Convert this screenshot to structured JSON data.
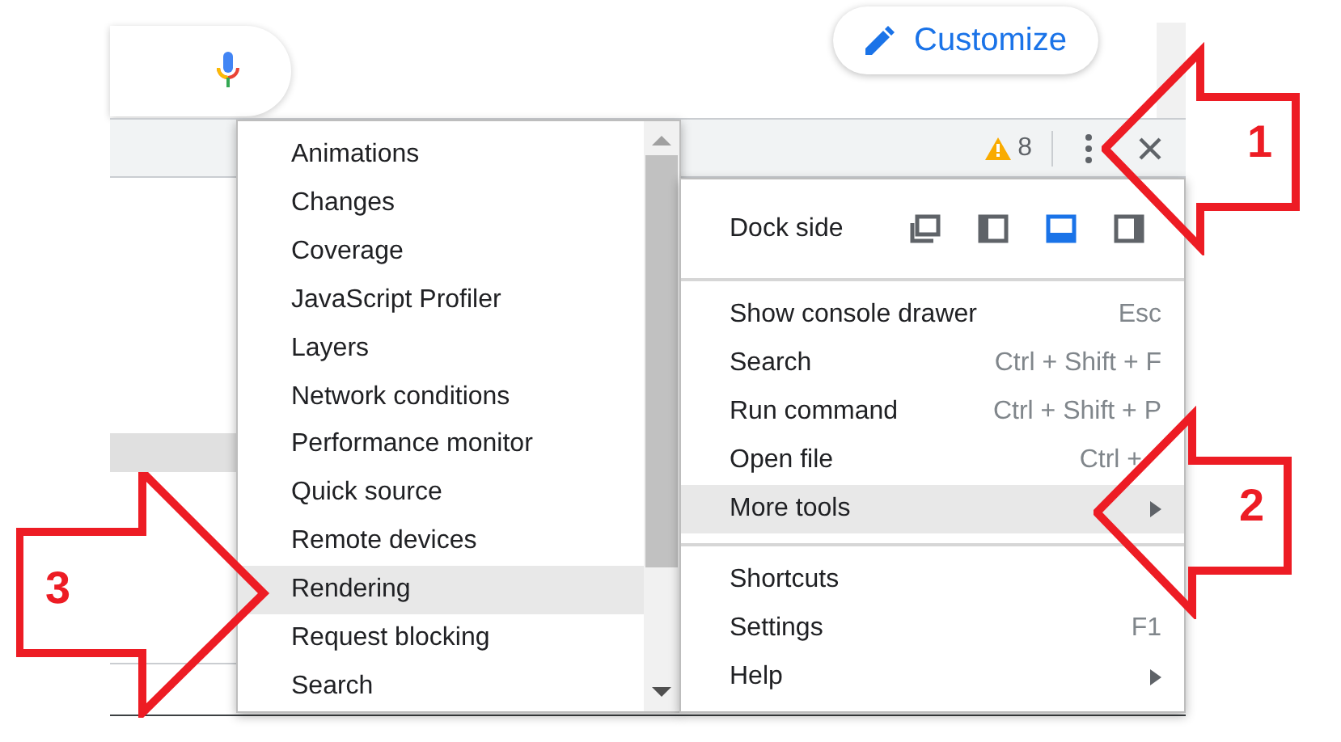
{
  "customize_button": {
    "label": "Customize"
  },
  "toolbar": {
    "warning_count": "8"
  },
  "more_tools_submenu": {
    "items": [
      {
        "label": "Animations",
        "selected": false
      },
      {
        "label": "Changes",
        "selected": false
      },
      {
        "label": "Coverage",
        "selected": false
      },
      {
        "label": "JavaScript Profiler",
        "selected": false
      },
      {
        "label": "Layers",
        "selected": false
      },
      {
        "label": "Network conditions",
        "selected": false
      },
      {
        "label": "Performance monitor",
        "selected": false
      },
      {
        "label": "Quick source",
        "selected": false
      },
      {
        "label": "Remote devices",
        "selected": false
      },
      {
        "label": "Rendering",
        "selected": true
      },
      {
        "label": "Request blocking",
        "selected": false
      },
      {
        "label": "Search",
        "selected": false
      }
    ]
  },
  "main_menu": {
    "dock_side": {
      "label": "Dock side",
      "options": [
        {
          "kind": "undock",
          "selected": false
        },
        {
          "kind": "left",
          "selected": false
        },
        {
          "kind": "bottom",
          "selected": true
        },
        {
          "kind": "right",
          "selected": false
        }
      ]
    },
    "groups": [
      [
        {
          "label": "Show console drawer",
          "shortcut": "Esc",
          "has_submenu": false,
          "selected": false
        },
        {
          "label": "Search",
          "shortcut": "Ctrl + Shift + F",
          "has_submenu": false,
          "selected": false
        },
        {
          "label": "Run command",
          "shortcut": "Ctrl + Shift + P",
          "has_submenu": false,
          "selected": false
        },
        {
          "label": "Open file",
          "shortcut": "Ctrl +",
          "has_submenu": false,
          "selected": false
        },
        {
          "label": "More tools",
          "has_submenu": true,
          "selected": true
        }
      ],
      [
        {
          "label": "Shortcuts",
          "has_submenu": false,
          "selected": false
        },
        {
          "label": "Settings",
          "shortcut": "F1",
          "has_submenu": false,
          "selected": false
        },
        {
          "label": "Help",
          "has_submenu": true,
          "selected": false
        }
      ]
    ]
  },
  "annotations": [
    {
      "kind": "left",
      "number": "1"
    },
    {
      "kind": "left",
      "number": "2"
    },
    {
      "kind": "right",
      "number": "3"
    }
  ]
}
